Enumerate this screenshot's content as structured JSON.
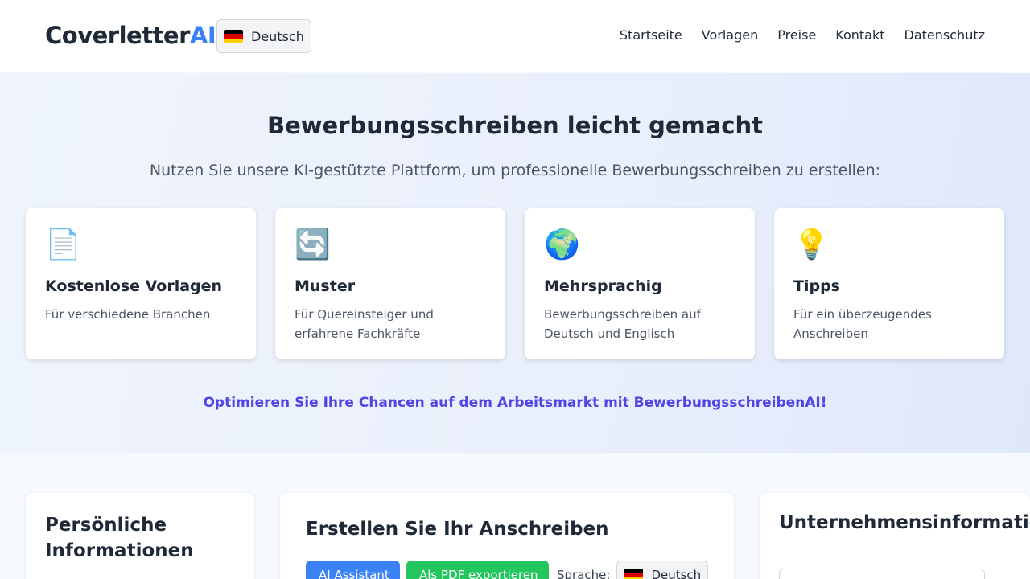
{
  "header": {
    "logo_main": "Coverletter",
    "logo_accent": "AI",
    "language": "Deutsch",
    "nav": [
      "Startseite",
      "Vorlagen",
      "Preise",
      "Kontakt",
      "Datenschutz"
    ]
  },
  "hero": {
    "title": "Bewerbungsschreiben leicht gemacht",
    "subtitle": "Nutzen Sie unsere KI-gestützte Plattform, um professionelle Bewerbungsschreiben zu erstellen:",
    "cards": [
      {
        "icon": "📄",
        "icon_name": "document-icon",
        "title": "Kostenlose Vorlagen",
        "text": "Für verschiedene Branchen"
      },
      {
        "icon": "🔄",
        "icon_name": "refresh-icon",
        "title": "Muster",
        "text": "Für Quereinsteiger und erfahrene Fachkräfte"
      },
      {
        "icon": "🌍",
        "icon_name": "globe-icon",
        "title": "Mehrsprachig",
        "text": "Bewerbungsschreiben auf Deutsch und Englisch"
      },
      {
        "icon": "💡",
        "icon_name": "lightbulb-icon",
        "title": "Tipps",
        "text": "Für ein überzeugendes Anschreiben"
      }
    ],
    "cta": "Optimieren Sie Ihre Chancen auf dem Arbeitsmarkt mit BewerbungsschreibenAI!"
  },
  "personal": {
    "title": "Persönliche Informationen"
  },
  "editor": {
    "title": "Erstellen Sie Ihr Anschreiben",
    "ai_button": "AI Assistant",
    "pdf_button": "Als PDF exportieren",
    "language_label": "Sprache:",
    "language_value": "Deutsch"
  },
  "company": {
    "title": "Unternehmensinformationen"
  },
  "colors": {
    "accent": "#3b82f6",
    "cta": "#4f46e5",
    "export_button": "#22c55e"
  }
}
